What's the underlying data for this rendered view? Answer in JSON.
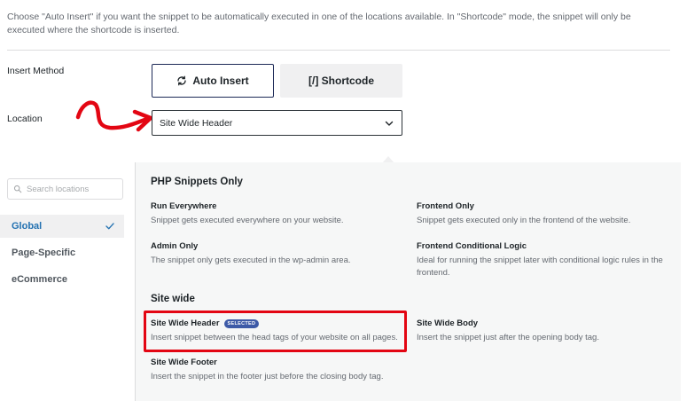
{
  "intro_text": "Choose \"Auto Insert\" if you want the snippet to be automatically executed in one of the locations available. In \"Shortcode\" mode, the snippet will only be executed where the shortcode is inserted.",
  "insert_method": {
    "label": "Insert Method",
    "auto_insert_label": "Auto Insert",
    "shortcode_label": "[/] Shortcode"
  },
  "location": {
    "label": "Location",
    "selected": "Site Wide Header"
  },
  "sidebar": {
    "search_placeholder": "Search locations",
    "items": [
      {
        "label": "Global",
        "active": true
      },
      {
        "label": "Page-Specific",
        "active": false
      },
      {
        "label": "eCommerce",
        "active": false
      }
    ]
  },
  "sections": {
    "php": {
      "title": "PHP Snippets Only",
      "options": [
        {
          "title": "Run Everywhere",
          "desc": "Snippet gets executed everywhere on your website."
        },
        {
          "title": "Frontend Only",
          "desc": "Snippet gets executed only in the frontend of the website."
        },
        {
          "title": "Admin Only",
          "desc": "The snippet only gets executed in the wp-admin area."
        },
        {
          "title": "Frontend Conditional Logic",
          "desc": "Ideal for running the snippet later with conditional logic rules in the frontend."
        }
      ]
    },
    "site_wide": {
      "title": "Site wide",
      "options": [
        {
          "title": "Site Wide Header",
          "desc": "Insert snippet between the head tags of your website on all pages.",
          "badge": "SELECTED"
        },
        {
          "title": "Site Wide Body",
          "desc": "Insert the snippet just after the opening body tag."
        },
        {
          "title": "Site Wide Footer",
          "desc": "Insert the snippet in the footer just before the closing body tag."
        }
      ]
    }
  },
  "colors": {
    "accent": "#2271b1",
    "highlight": "#e30613",
    "badge": "#3d5aa7"
  },
  "icons": {
    "auto_insert": "refresh-icon",
    "search": "search-icon",
    "dropdown": "chevron-down-icon",
    "active_check": "check-icon",
    "annotation": "red-arrow"
  }
}
